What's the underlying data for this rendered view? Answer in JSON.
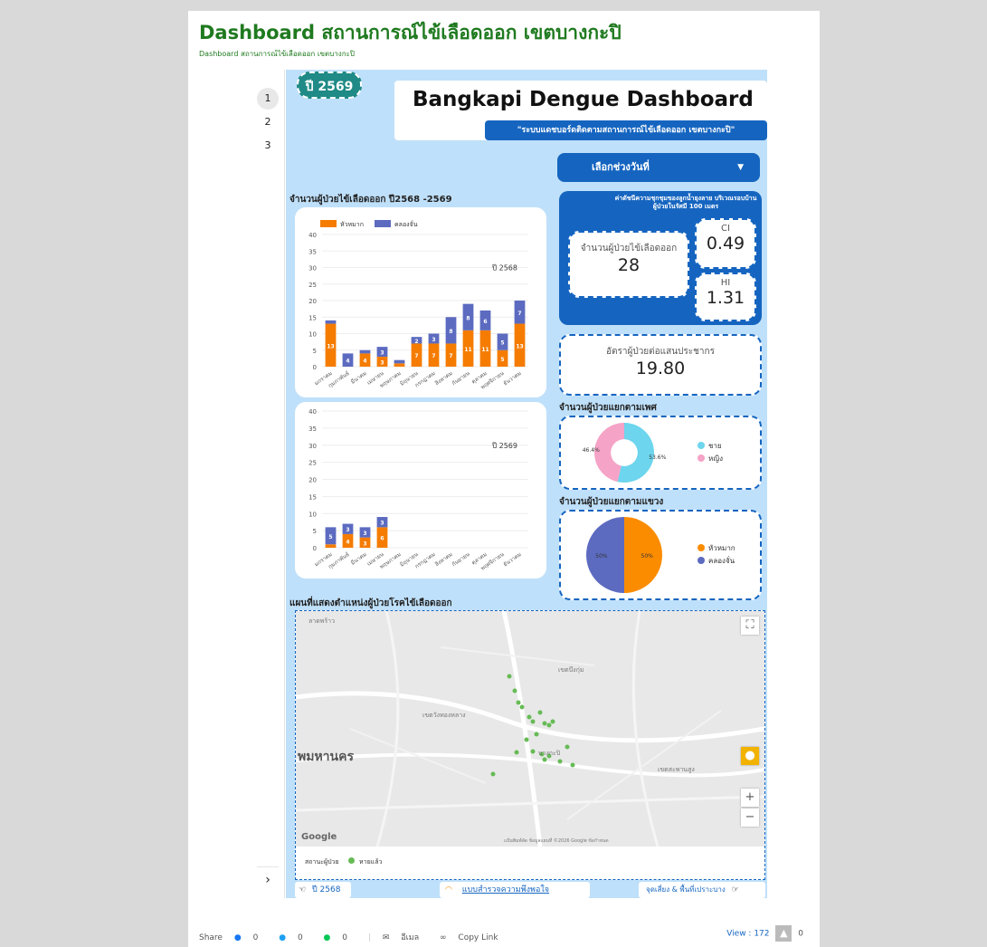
{
  "page": {
    "title": "Dashboard สถานการณ์ไข้เลือดออก เขตบางกะปิ",
    "subtitle": "Dashboard สถานการณ์ไข้เลือดออก เขตบางกะปิ"
  },
  "pager": {
    "pages": [
      "1",
      "2",
      "3"
    ],
    "next": "›"
  },
  "header": {
    "year_badge": "ปี 2569",
    "title": "Bangkapi Dengue Dashboard",
    "tagline": "\"ระบบแดชบอร์ดติดตามสถานการณ์ไข้เลือดออก เขตบางกะปิ\""
  },
  "date_picker": {
    "label": "เลือกช่วงวันที่",
    "caret": "▼"
  },
  "sections": {
    "cases_chart": "จำนวนผู้ป่วยไข้เลือดออก ปี2568 -2569",
    "gender": "จำนวนผู้ป่วยแยกตามเพศ",
    "district": "จำนวนผู้ป่วยแยกตามแขวง",
    "map": "แผนที่แสดงตำแหน่งผู้ป่วยโรคไข้เลือดออก"
  },
  "kpi": {
    "header": "ค่าดัชนีความชุกชุมของลูกน้ำยุงลาย บริเวณรอบบ้านผู้ป่วยในรัศมี 100 เมตร",
    "cases_label": "จำนวนผู้ป่วยไข้เลือดออก",
    "cases_value": "28",
    "ci_label": "CI",
    "ci_value": "0.49",
    "hi_label": "HI",
    "hi_value": "1.31",
    "rate_label": "อัตราผู้ป่วยต่อแสนประชากร",
    "rate_value": "19.80"
  },
  "chart_data": [
    {
      "type": "bar",
      "stacked": true,
      "year_label": "ปี 2568",
      "categories": [
        "มกราคม",
        "กุมภาพันธ์",
        "มีนาคม",
        "เมษายน",
        "พฤษภาคม",
        "มิถุนายน",
        "กรกฎาคม",
        "สิงหาคม",
        "กันยายน",
        "ตุลาคม",
        "พฤศจิกายน",
        "ธันวาคม"
      ],
      "series": [
        {
          "name": "หัวหมาก",
          "color": "#f57c00",
          "values": [
            13,
            0,
            4,
            3,
            1,
            7,
            7,
            7,
            11,
            11,
            5,
            13
          ]
        },
        {
          "name": "คลองจั่น",
          "color": "#5c6bc0",
          "values": [
            1,
            4,
            1,
            3,
            1,
            2,
            3,
            8,
            8,
            6,
            5,
            7
          ]
        }
      ],
      "ylim": [
        0,
        40
      ],
      "yticks": [
        0,
        5,
        10,
        15,
        20,
        25,
        30,
        35,
        40
      ],
      "legend": "top-left"
    },
    {
      "type": "bar",
      "stacked": true,
      "year_label": "ปี 2569",
      "categories": [
        "มกราคม",
        "กุมภาพันธ์",
        "มีนาคม",
        "เมษายน",
        "พฤษภาคม",
        "มิถุนายน",
        "กรกฎาคม",
        "สิงหาคม",
        "กันยายน",
        "ตุลาคม",
        "พฤศจิกายน",
        "ธันวาคม"
      ],
      "series": [
        {
          "name": "หัวหมาก",
          "color": "#f57c00",
          "values": [
            1,
            4,
            3,
            6,
            0,
            0,
            0,
            0,
            0,
            0,
            0,
            0
          ]
        },
        {
          "name": "คลองจั่น",
          "color": "#5c6bc0",
          "values": [
            5,
            3,
            3,
            3,
            0,
            0,
            0,
            0,
            0,
            0,
            0,
            0
          ]
        }
      ],
      "ylim": [
        0,
        40
      ],
      "yticks": [
        0,
        5,
        10,
        15,
        20,
        25,
        30,
        35,
        40
      ]
    },
    {
      "type": "pie",
      "donut": true,
      "slices": [
        {
          "name": "ชาย",
          "value": 53.6,
          "label": "53.6%",
          "color": "#6dd5ed"
        },
        {
          "name": "หญิง",
          "value": 46.4,
          "label": "46.4%",
          "color": "#f5a3c7"
        }
      ],
      "legend": "right"
    },
    {
      "type": "pie",
      "slices": [
        {
          "name": "หัวหมาก",
          "value": 50,
          "label": "50%",
          "color": "#fb8c00"
        },
        {
          "name": "คลองจั่น",
          "value": 50,
          "label": "50%",
          "color": "#5c6bc0"
        }
      ],
      "legend": "right"
    }
  ],
  "map": {
    "place_labels": [
      "ลาดพร้าว",
      "เขตบึงกุ่ม",
      "บางกะปิ",
      "พมหานคร",
      "เขตวังทองหลาง",
      "เขตสะพานสูง"
    ],
    "legend_title": "สถานะผู้ป่วย",
    "legend_item": "หายแล้ว",
    "attribution": "แป้นพิมพ์ลัด  ข้อมูลแผนที่ ©2026 Google  ข้อกำหนด",
    "google": "Google",
    "zoom_in": "+",
    "zoom_out": "−",
    "fullscreen": "⛶"
  },
  "bottom": {
    "prev": "ปี 2568",
    "survey": "แบบสำรวจความพึงพอใจ",
    "next": "จุดเสี่ยง & พื้นที่เปราะบาง"
  },
  "social": {
    "share": "Share",
    "fb": "0",
    "tw": "0",
    "line": "0",
    "email": "อีเมล",
    "copy": "Copy Link",
    "view": "View : 172",
    "likes": "0"
  }
}
